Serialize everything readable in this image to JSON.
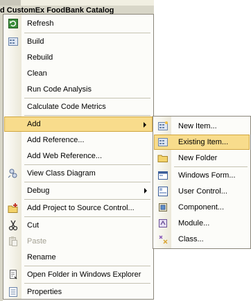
{
  "background": {
    "title": "d CustomEx FoodBank Catalog"
  },
  "context_menu": {
    "items": [
      {
        "label": "Refresh",
        "icon": "refresh-icon"
      },
      {
        "label": "Build"
      },
      {
        "label": "Rebuild"
      },
      {
        "label": "Clean"
      },
      {
        "label": "Run Code Analysis"
      },
      {
        "label": "Calculate Code Metrics"
      },
      {
        "label": "Add"
      },
      {
        "label": "Add Reference..."
      },
      {
        "label": "Add Web Reference..."
      },
      {
        "label": "View Class Diagram",
        "icon": "class-diagram-icon"
      },
      {
        "label": "Debug"
      },
      {
        "label": "Add Project to Source Control...",
        "icon": "source-control-icon"
      },
      {
        "label": "Cut",
        "icon": "scissors-icon"
      },
      {
        "label": "Paste",
        "icon": "paste-icon",
        "disabled": true
      },
      {
        "label": "Rename"
      },
      {
        "label": "Open Folder in Windows Explorer"
      },
      {
        "label": "Properties",
        "icon": "properties-icon"
      }
    ]
  },
  "add_submenu": {
    "items": [
      {
        "label": "New Item...",
        "icon": "new-item-icon"
      },
      {
        "label": "Existing Item...",
        "icon": "existing-item-icon"
      },
      {
        "label": "New Folder",
        "icon": "folder-icon"
      },
      {
        "label": "Windows Form...",
        "icon": "windows-form-icon"
      },
      {
        "label": "User Control...",
        "icon": "user-control-icon"
      },
      {
        "label": "Component...",
        "icon": "component-icon"
      },
      {
        "label": "Module...",
        "icon": "module-icon"
      },
      {
        "label": "Class...",
        "icon": "class-icon"
      }
    ]
  },
  "colors": {
    "highlight": "#f8dc8c",
    "highlight_border": "#d0a640",
    "menu_border": "#8a867a",
    "gutter": "#ebe8d9"
  }
}
